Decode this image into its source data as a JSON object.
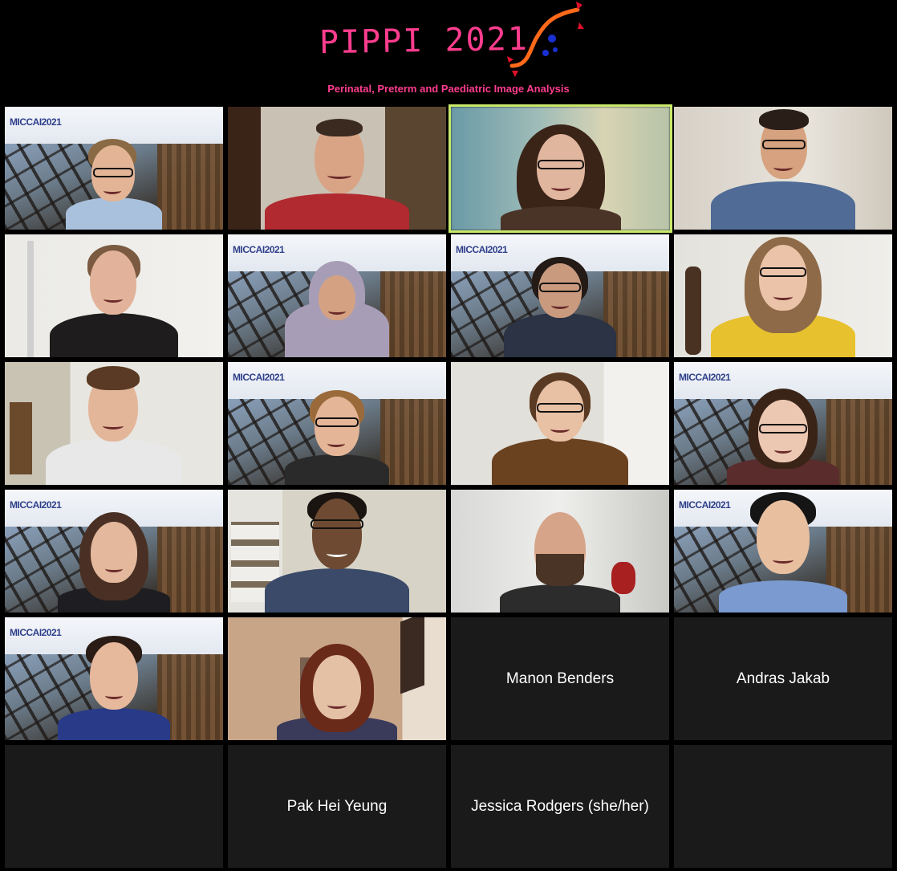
{
  "header": {
    "logo_text": "PIPPI 2021",
    "subtitle": "Perinatal, Preterm and Paediatric Image Analysis"
  },
  "background": {
    "banner_logo": "MICCAI2021"
  },
  "participants": [
    {
      "name": "Manon Benders"
    },
    {
      "name": "Andras Jakab"
    },
    {
      "name": "Pak Hei Yeung"
    },
    {
      "name": "Jessica Rodgers (she/her)"
    }
  ],
  "colors": {
    "brand_pink": "#ff3d8e",
    "active_speaker_border": "#c8e86a",
    "tile_empty": "#1a1a1a"
  }
}
